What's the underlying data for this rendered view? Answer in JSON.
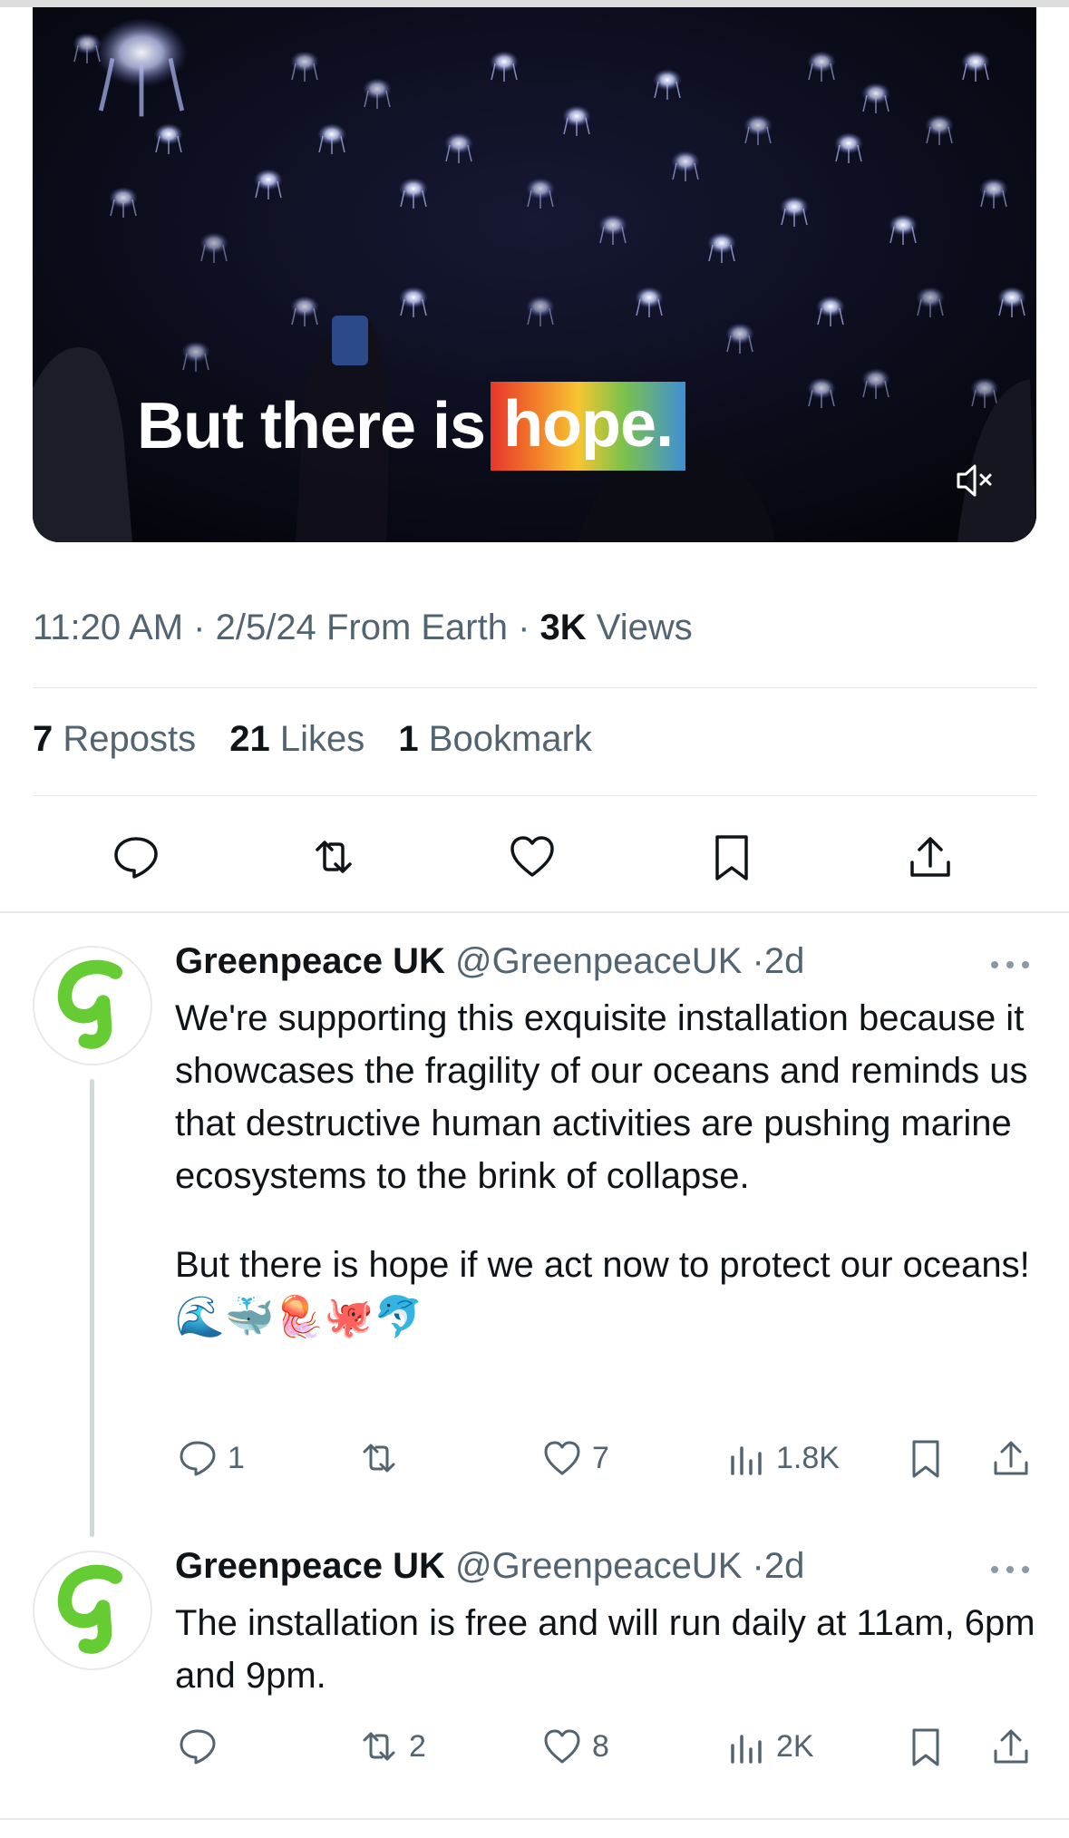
{
  "video": {
    "caption_plain": "But there is",
    "caption_highlight": "hope.",
    "mute_icon": "speaker-muted-icon"
  },
  "tweet": {
    "time": "11:20 AM",
    "date": "2/5/24",
    "source": "From Earth",
    "views_count": "3K",
    "views_label": "Views",
    "reposts_count": "7",
    "reposts_label": "Reposts",
    "likes_count": "21",
    "likes_label": "Likes",
    "bookmarks_count": "1",
    "bookmarks_label": "Bookmark",
    "actions": [
      "reply-icon",
      "repost-icon",
      "like-icon",
      "bookmark-icon",
      "share-icon"
    ]
  },
  "replies": [
    {
      "name": "Greenpeace UK",
      "handle": "@GreenpeaceUK",
      "age": "2d",
      "text_p1": "We're supporting this exquisite installation because it showcases the fragility of our oceans and reminds us that destructive human activities are pushing marine ecosystems to the brink of collapse.",
      "text_p2": "But there is hope if we act now to protect our oceans!",
      "emoji": "🌊🐳🪼🐙🐬",
      "reply_count": "1",
      "repost_count": "",
      "like_count": "7",
      "views": "1.8K"
    },
    {
      "name": "Greenpeace UK",
      "handle": "@GreenpeaceUK",
      "age": "2d",
      "text_p1": "The installation is free and will run daily at 11am, 6pm and 9pm.",
      "reply_count": "",
      "repost_count": "2",
      "like_count": "8",
      "views": "2K"
    }
  ],
  "colors": {
    "brand_green": "#66cc33",
    "muted_text": "#536471",
    "primary_text": "#0f1419"
  }
}
